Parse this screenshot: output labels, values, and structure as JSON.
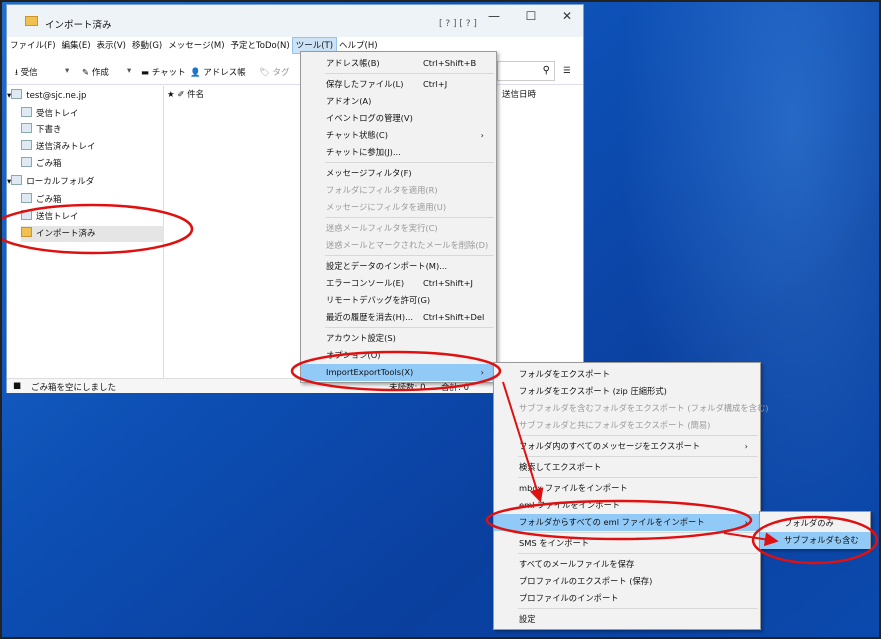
{
  "window": {
    "title": "インポート済み",
    "extra": "[ ? ] [ ? ]"
  },
  "menubar": [
    "ファイル(F)",
    "編集(E)",
    "表示(V)",
    "移動(G)",
    "メッセージ(M)",
    "予定とToDo(N)",
    "ツール(T)",
    "ヘルプ(H)"
  ],
  "toolbar": {
    "get": "⭳ 受信",
    "write": "✎ 作成",
    "chat": "▬ チャット",
    "address": "👤 アドレス帳",
    "tag": "🏷 タグ"
  },
  "folders": [
    "test@sjc.ne.jp",
    "受信トレイ",
    "下書き",
    "送信済みトレイ",
    "ごみ箱",
    "ローカルフォルダ",
    "ごみ箱",
    "送信トレイ",
    "インポート済み"
  ],
  "msglist": {
    "cols": "★ ✐   件名",
    "date": "送信日時"
  },
  "status": {
    "left": "ごみ箱を空にしました",
    "unread": "未読数: 0",
    "total": "合計: 0"
  },
  "tools_menu": [
    {
      "label": "アドレス帳(B)",
      "key": "Ctrl+Shift+B"
    },
    {
      "sep": true
    },
    {
      "label": "保存したファイル(L)",
      "key": "Ctrl+J"
    },
    {
      "label": "アドオン(A)"
    },
    {
      "label": "イベントログの管理(V)"
    },
    {
      "label": "チャット状態(C)",
      "sub": true
    },
    {
      "label": "チャットに参加(J)..."
    },
    {
      "sep": true
    },
    {
      "label": "メッセージフィルタ(F)"
    },
    {
      "label": "フォルダにフィルタを適用(R)",
      "dis": true
    },
    {
      "label": "メッセージにフィルタを適用(U)",
      "dis": true
    },
    {
      "sep": true
    },
    {
      "label": "迷惑メールフィルタを実行(C)",
      "dis": true
    },
    {
      "label": "迷惑メールとマークされたメールを削除(D)",
      "dis": true
    },
    {
      "sep": true
    },
    {
      "label": "設定とデータのインポート(M)..."
    },
    {
      "label": "エラーコンソール(E)",
      "key": "Ctrl+Shift+J"
    },
    {
      "label": "リモートデバッグを許可(G)"
    },
    {
      "label": "最近の履歴を消去(H)...",
      "key": "Ctrl+Shift+Del"
    },
    {
      "sep": true
    },
    {
      "label": "アカウント設定(S)"
    },
    {
      "label": "オプション(O)"
    },
    {
      "label": "ImportExportTools(X)",
      "sub": true,
      "hl": true
    }
  ],
  "iet_menu": [
    {
      "label": "フォルダをエクスポート"
    },
    {
      "label": "フォルダをエクスポート (zip 圧縮形式)"
    },
    {
      "label": "サブフォルダを含むフォルダをエクスポート (フォルダ構成を含む)",
      "dis": true
    },
    {
      "label": "サブフォルダと共にフォルダをエクスポート (簡易)",
      "dis": true
    },
    {
      "sep": true
    },
    {
      "label": "フォルダ内のすべてのメッセージをエクスポート",
      "sub": true
    },
    {
      "sep": true
    },
    {
      "label": "検索してエクスポート"
    },
    {
      "sep": true
    },
    {
      "label": "mbox ファイルをインポート"
    },
    {
      "label": "eml ファイルをインポート"
    },
    {
      "label": "フォルダからすべての eml ファイルをインポート",
      "sub": true,
      "hl": true
    },
    {
      "sep": true
    },
    {
      "label": "SMS をインポート"
    },
    {
      "sep": true
    },
    {
      "label": "すべてのメールファイルを保存"
    },
    {
      "label": "プロファイルのエクスポート (保存)"
    },
    {
      "label": "プロファイルのインポート"
    },
    {
      "sep": true
    },
    {
      "label": "設定"
    }
  ],
  "sub_menu": [
    {
      "label": "フォルダのみ"
    },
    {
      "label": "サブフォルダも含む",
      "hl": true
    }
  ],
  "colors": {
    "desktop": "#0d4fb4",
    "highlight": "#91c9f7",
    "annotation": "#e01010"
  }
}
